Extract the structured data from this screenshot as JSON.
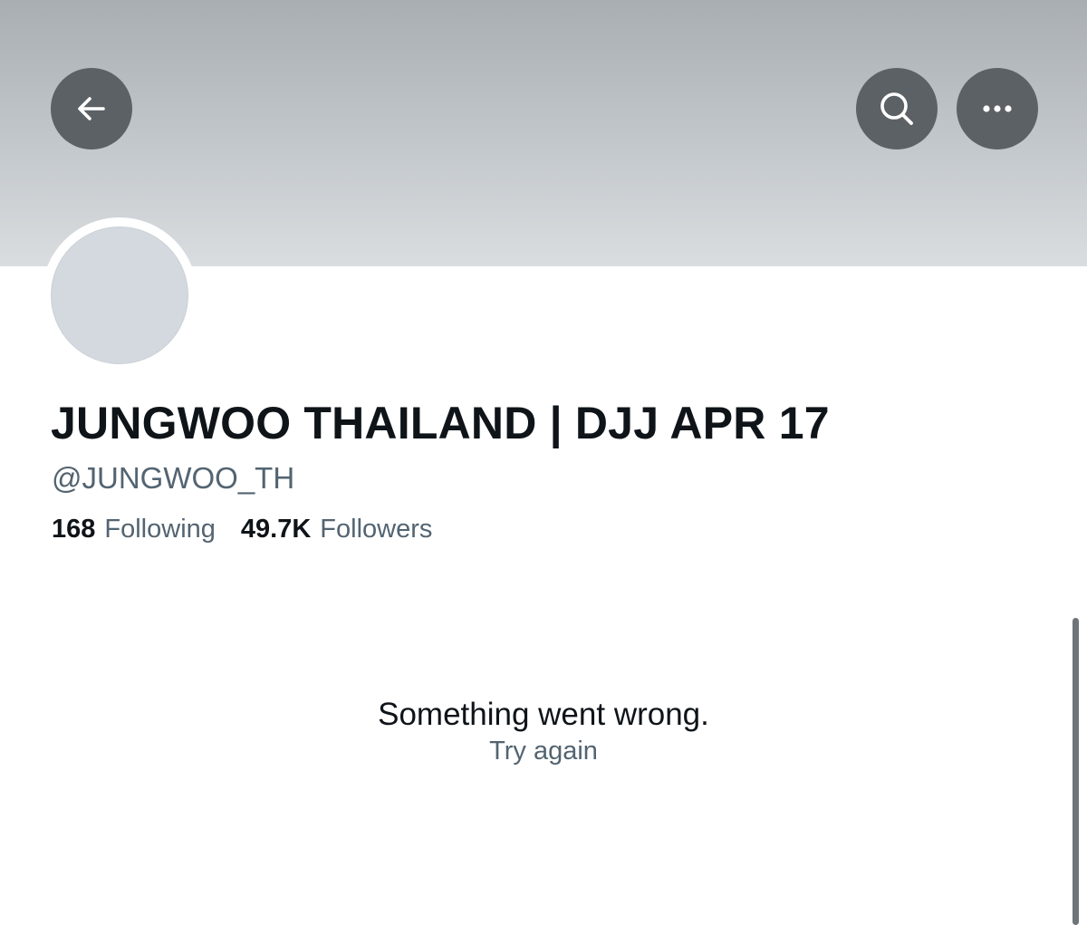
{
  "header": {
    "back_icon": "arrow-left-icon",
    "search_icon": "search-icon",
    "more_icon": "more-dots-icon"
  },
  "profile": {
    "display_name": "JUNGWOO THAILAND | DJJ APR 17",
    "handle": "@JUNGWOO_TH",
    "following_count": "168",
    "following_label": "Following",
    "followers_count": "49.7K",
    "followers_label": "Followers"
  },
  "error": {
    "message": "Something went wrong.",
    "retry_label": "Try again"
  },
  "colors": {
    "primary_text": "#0f1419",
    "secondary_text": "#536471",
    "button_bg": "#5c6165",
    "avatar_placeholder": "#d3d9de"
  }
}
